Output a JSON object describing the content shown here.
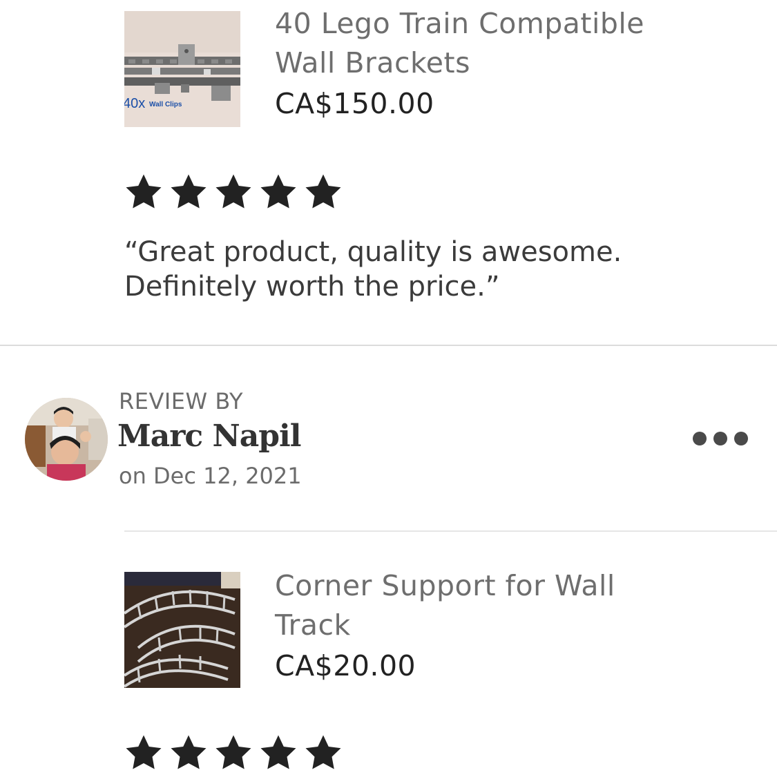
{
  "reviews_top": {
    "product": {
      "title": "40 Lego Train Compatible Wall Brackets",
      "title_line1": "40 Lego Train Compatible",
      "title_line2": "Wall Brackets",
      "price": "CA$150.00",
      "thumbnail_caption": "40x Wall Clips"
    },
    "rating": 5,
    "review_text_line1": "“Great product, quality is awesome.",
    "review_text_line2": "Definitely worth the price.”"
  },
  "review_next": {
    "label": "REVIEW BY",
    "reviewer_name": "Marc Napil",
    "date": "on Dec 12, 2021",
    "more_icon": "more-horizontal-icon",
    "product": {
      "title_line1": "Corner Support for Wall",
      "title_line2": "Track",
      "price": "CA$20.00"
    },
    "rating": 5
  },
  "colors": {
    "star": "#222222",
    "title_gray": "#6e6e6e",
    "divider": "#dcdcdc"
  }
}
